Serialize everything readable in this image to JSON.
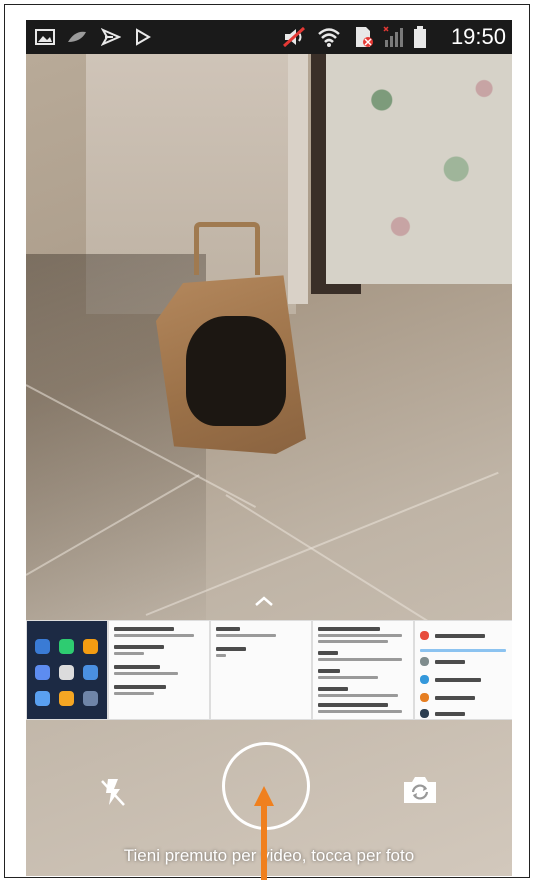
{
  "status_bar": {
    "time": "19:50",
    "icons": [
      "gallery-icon",
      "leaf-icon",
      "cast-icon",
      "play-store-icon",
      "mute-icon",
      "wifi-icon",
      "sim-disabled-icon",
      "signal-icon",
      "battery-icon"
    ]
  },
  "camera": {
    "hint": "Tieni premuto per video, tocca per foto",
    "controls": [
      "flash-off-icon",
      "shutter-button",
      "switch-camera-icon"
    ]
  },
  "recents": {
    "count_visible": 5
  },
  "colors": {
    "accent_arrow": "#f0801e",
    "status_bar_bg": "#1a1a1a"
  }
}
